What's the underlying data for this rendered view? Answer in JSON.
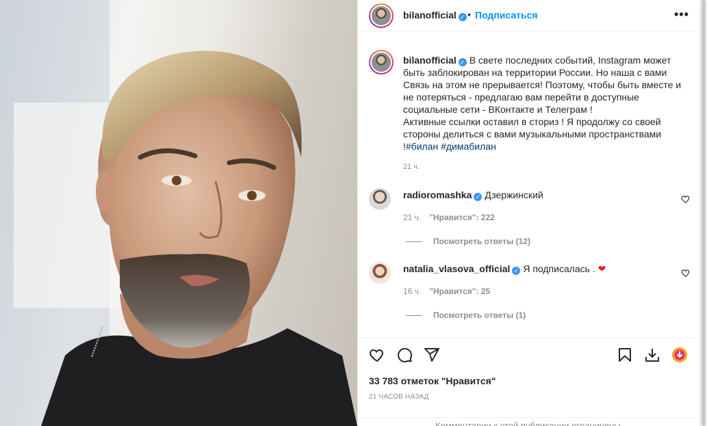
{
  "post": {
    "username": "bilanofficial",
    "dot": "•",
    "follow_label": "Подписаться",
    "more_label": "•••",
    "caption_text": "В свете последних событий, Instagram может быть заблокирован на территории России. Но наша с вами Связь на этом не прерывается! Поэтому, чтобы быть вместе и не потеряться - предлагаю вам перейти в доступные социальные сети - ВКонтакте и Телеграм !\nАктивные ссылки оставил в сториз ! Я продолжу со своей стороны делиться с вами музыкальными пространствами !",
    "hashtags": [
      "#билан",
      "#димабилан"
    ],
    "caption_time": "21 ч.",
    "likes": "33 783 отметок \"Нравится\"",
    "posted_ago": "21 ЧАСОВ НАЗАД",
    "comments_limited": "Комментарии к этой публикации ограничены."
  },
  "comments": [
    {
      "username": "radioromashka",
      "text": "Дзержинский",
      "time": "21 ч.",
      "likes": "\"Нравится\": 222",
      "replies": "Посмотреть ответы (12)"
    },
    {
      "username": "natalia_vlasova_official",
      "text": "Я подписалась .",
      "emoji": "❤",
      "time": "16 ч.",
      "likes": "\"Нравится\": 25",
      "replies": "Посмотреть ответы (1)"
    }
  ],
  "icons": {
    "verified": "verified-badge-icon",
    "like": "heart-icon",
    "comment": "comment-icon",
    "share": "paper-plane-icon",
    "save": "bookmark-icon",
    "download": "download-icon",
    "extension": "extension-icon"
  },
  "colors": {
    "accent": "#0095f6",
    "verified": "#3897f0",
    "muted": "#8e8e8e",
    "heart_red": "#ed1c24",
    "extension_orange": "#f6a21c"
  }
}
